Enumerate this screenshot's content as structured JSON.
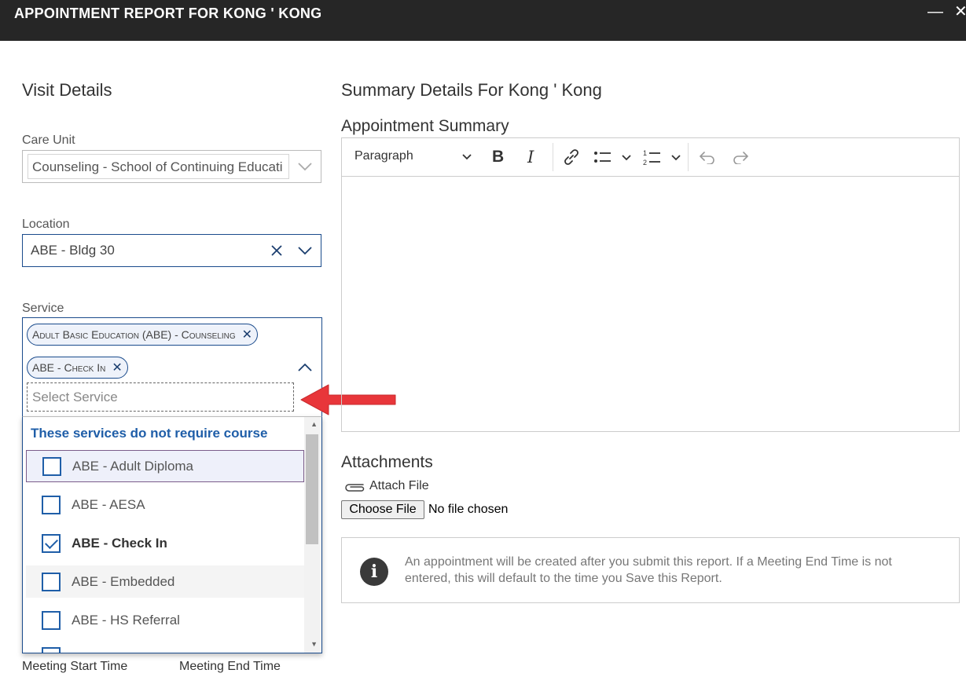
{
  "window": {
    "title": "APPOINTMENT REPORT FOR KONG ' KONG",
    "minimize_glyph": "—",
    "close_glyph": "✕"
  },
  "visit_details": {
    "heading": "Visit Details",
    "care_unit": {
      "label": "Care Unit",
      "value": "Counseling - School of Continuing Educati"
    },
    "location": {
      "label": "Location",
      "value": "ABE - Bldg 30"
    },
    "service": {
      "label": "Service",
      "selected_chips": [
        "Adult Basic Education (ABE) - Counseling",
        "ABE - Check In"
      ],
      "placeholder": "Select Service",
      "dropdown_header": "These services do not require course",
      "options": [
        {
          "label": "ABE - Adult Diploma",
          "checked": false
        },
        {
          "label": "ABE - AESA",
          "checked": false
        },
        {
          "label": "ABE - Check In",
          "checked": true
        },
        {
          "label": "ABE - Embedded",
          "checked": false
        },
        {
          "label": "ABE - HS Referral",
          "checked": false
        }
      ]
    },
    "meeting_start_label": "Meeting Start Time",
    "meeting_end_label": "Meeting End Time"
  },
  "summary": {
    "heading": "Summary Details For Kong ' Kong",
    "appointment_summary_label": "Appointment Summary",
    "toolbar": {
      "paragraph_label": "Paragraph"
    }
  },
  "attachments": {
    "heading": "Attachments",
    "attach_label": "Attach File",
    "choose_button": "Choose File",
    "no_file_text": "No file chosen"
  },
  "info": {
    "icon": "info-icon",
    "text": "An appointment will be created after you submit this report. If a Meeting End Time is not entered, this will default to the time you Save this Report."
  },
  "colors": {
    "accent": "#1f5ea8",
    "titlebar": "#262626",
    "annotation_arrow": "#e8363a"
  }
}
